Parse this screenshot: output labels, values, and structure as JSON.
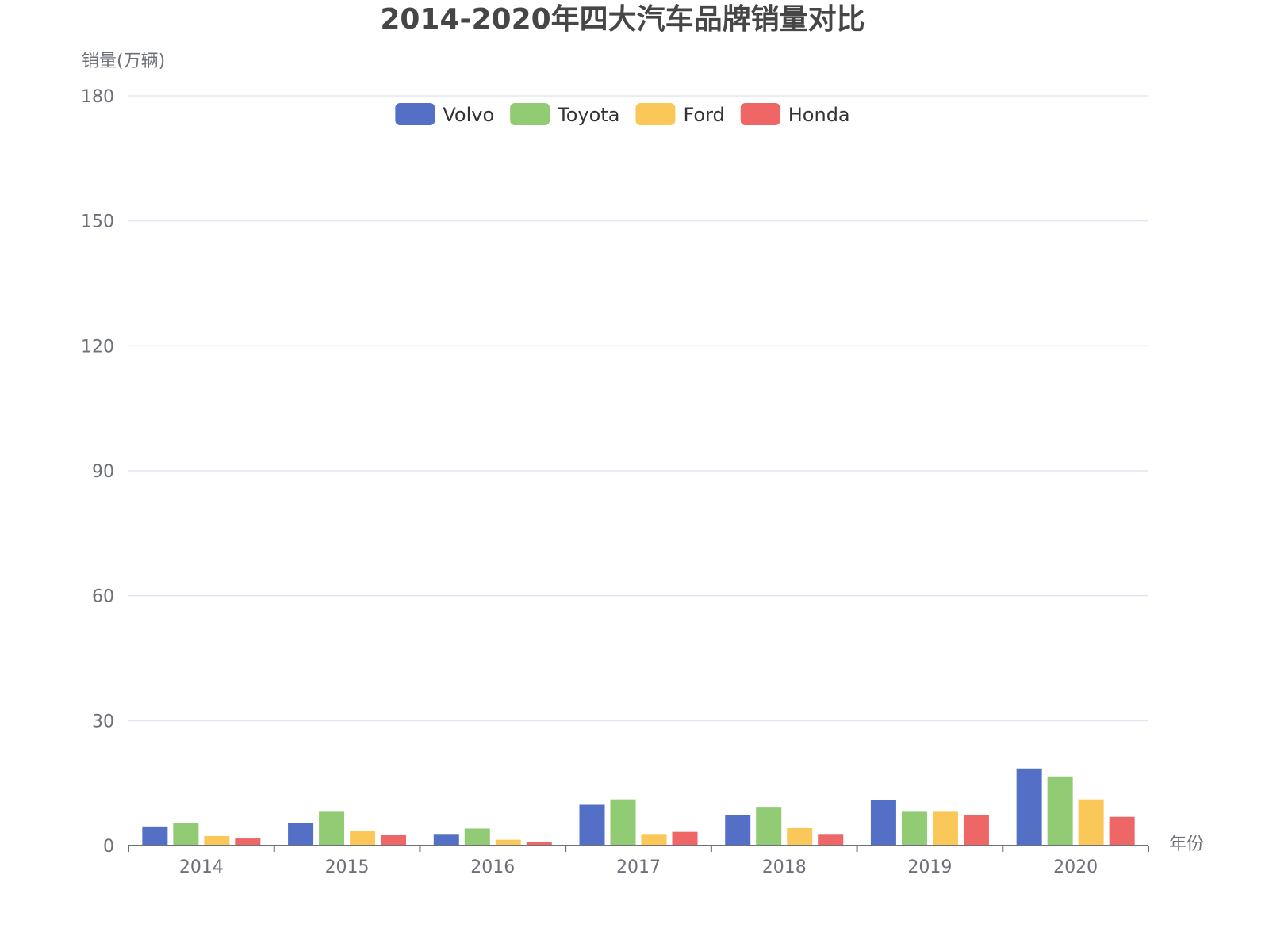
{
  "chart_data": {
    "type": "bar",
    "title": "2014-2020年四大汽车品牌销量对比",
    "xlabel": "年份",
    "ylabel": "销量(万辆)",
    "categories": [
      "2014",
      "2015",
      "2016",
      "2017",
      "2018",
      "2019",
      "2020"
    ],
    "ylim": [
      0,
      180
    ],
    "yticks": [
      0,
      30,
      60,
      90,
      120,
      150,
      180
    ],
    "grid": true,
    "legend_position": "top-center",
    "series": [
      {
        "name": "Volvo",
        "color": "#5470c6",
        "values": [
          4.6,
          5.5,
          2.8,
          9.8,
          7.4,
          11.0,
          18.5
        ]
      },
      {
        "name": "Toyota",
        "color": "#91cc75",
        "values": [
          5.5,
          8.3,
          4.1,
          11.1,
          9.3,
          8.3,
          16.6
        ]
      },
      {
        "name": "Ford",
        "color": "#fac858",
        "values": [
          2.3,
          3.6,
          1.4,
          2.8,
          4.2,
          8.3,
          11.1
        ]
      },
      {
        "name": "Honda",
        "color": "#ee6666",
        "values": [
          1.7,
          2.6,
          0.8,
          3.3,
          2.8,
          7.4,
          6.9
        ]
      }
    ]
  }
}
